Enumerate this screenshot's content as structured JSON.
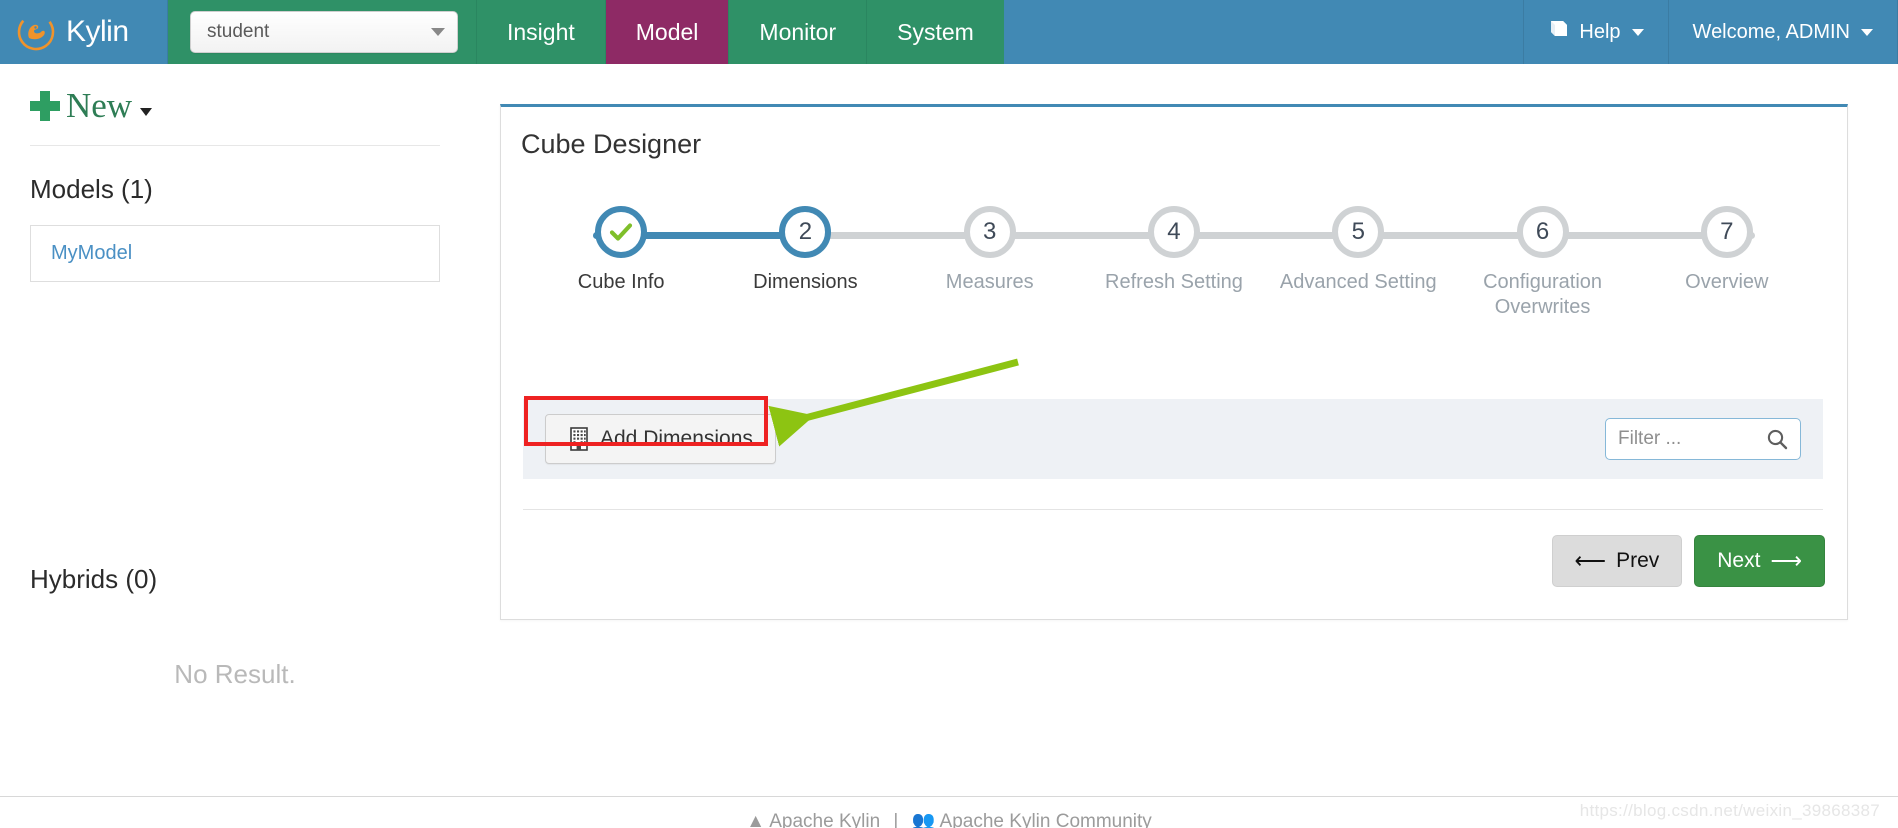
{
  "navbar": {
    "brand": "Kylin",
    "brand_logo_icon": "kylin-griffin-logo",
    "project_select": {
      "value": "student",
      "caret_icon": "caret-down-icon"
    },
    "tabs": [
      {
        "label": "Insight",
        "active": false
      },
      {
        "label": "Model",
        "active": true
      },
      {
        "label": "Monitor",
        "active": false
      },
      {
        "label": "System",
        "active": false
      }
    ],
    "help": {
      "label": "Help",
      "icon": "book-icon",
      "caret_icon": "caret-down-icon"
    },
    "user": {
      "label": "Welcome, ADMIN",
      "caret_icon": "caret-down-icon"
    }
  },
  "sidebar": {
    "new_button": {
      "label": "New",
      "plus_icon": "plus-icon",
      "caret_icon": "caret-down-icon"
    },
    "models_heading": "Models (1)",
    "models": [
      {
        "name": "MyModel"
      }
    ],
    "hybrids_heading": "Hybrids (0)",
    "hybrids_empty": "No Result."
  },
  "panel": {
    "title": "Cube Designer",
    "steps": [
      {
        "num": "1",
        "label": "Cube Info",
        "state": "done"
      },
      {
        "num": "2",
        "label": "Dimensions",
        "state": "active"
      },
      {
        "num": "3",
        "label": "Measures",
        "state": "pending"
      },
      {
        "num": "4",
        "label": "Refresh Setting",
        "state": "pending"
      },
      {
        "num": "5",
        "label": "Advanced Setting",
        "state": "pending"
      },
      {
        "num": "6",
        "label": "Configuration Overwrites",
        "state": "pending"
      },
      {
        "num": "7",
        "label": "Overview",
        "state": "pending"
      }
    ],
    "toolbar": {
      "add_dimensions_label": "Add Dimensions",
      "add_dimensions_icon": "building-icon",
      "filter": {
        "value": "",
        "placeholder": "Filter ...",
        "icon": "search-icon"
      }
    },
    "actions": {
      "prev_label": "Prev",
      "prev_icon": "arrow-left-icon",
      "next_label": "Next",
      "next_icon": "arrow-right-icon"
    }
  },
  "annotations": {
    "highlight_box_color": "#ee2222",
    "arrow_color": "#8dc412",
    "target": "Add Dimensions"
  },
  "footer": {
    "link_apache_kylin": "Apache Kylin",
    "separator": "|",
    "link_community": "Apache Kylin Community",
    "watermark": "https://blog.csdn.net/weixin_39868387"
  }
}
